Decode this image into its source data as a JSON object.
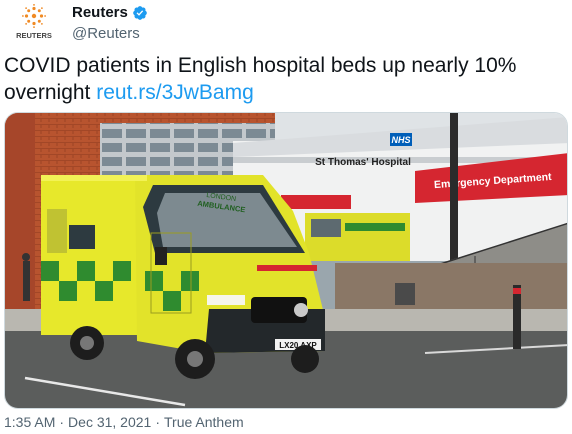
{
  "account": {
    "name": "Reuters",
    "handle": "@Reuters",
    "logo_caption": "REUTERS"
  },
  "tweet": {
    "text": "COVID patients in English hospital beds up nearly 10% overnight",
    "link": "reut.rs/3JwBamg"
  },
  "media": {
    "hospital_sign_nhs": "NHS",
    "hospital_name": "St Thomas' Hospital",
    "department_sign": "Emergency Department",
    "ambulance_text_1": "LONDON",
    "ambulance_text_2": "AMBULANCE",
    "plate": "LX20 AXP"
  },
  "meta": {
    "time": "1:35 AM",
    "sep1": "·",
    "date": "Dec 31, 2021",
    "sep2": "·",
    "source": "True Anthem"
  },
  "colors": {
    "brand_orange": "#f08a24",
    "verified_blue": "#1d9bf0",
    "link_blue": "#1d9bf0",
    "ambulance_yellow": "#e7e82b",
    "ambulance_green": "#2f8b2f",
    "emergency_red": "#d52630"
  }
}
